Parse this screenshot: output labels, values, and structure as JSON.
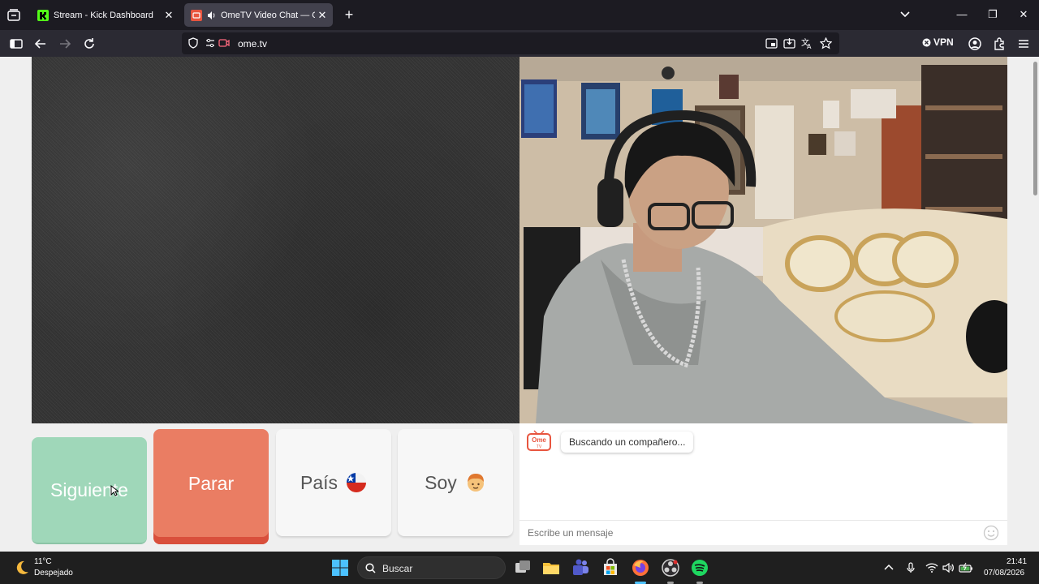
{
  "browser": {
    "tabs": [
      {
        "label": "Stream - Kick Dashboard",
        "close": "✕"
      },
      {
        "label": "OmeTV Video Chat — Ome",
        "close": "✕"
      }
    ],
    "new_tab": "+",
    "url": "ome.tv",
    "vpn_label": "VPN",
    "window_controls": {
      "minimize": "—",
      "maximize": "❐",
      "close": "✕"
    }
  },
  "page": {
    "buttons": {
      "next": "Siguiente",
      "stop": "Parar",
      "country": "País",
      "gender": "Soy"
    },
    "chat": {
      "logo_text": "Ome",
      "logo_sub": "TV",
      "status_message": "Buscando un compañero...",
      "input_placeholder": "Escribe un mensaje"
    }
  },
  "taskbar": {
    "weather": {
      "temp": "11°C",
      "condition": "Despejado"
    },
    "search_label": "Buscar",
    "clock": {
      "time": "21:41",
      "date": "07/08/2026"
    }
  },
  "colors": {
    "next_button": "#9fd7b9",
    "stop_button": "#ea7d63",
    "option_button": "#f7f7f7",
    "brand_red": "#e8553f"
  }
}
